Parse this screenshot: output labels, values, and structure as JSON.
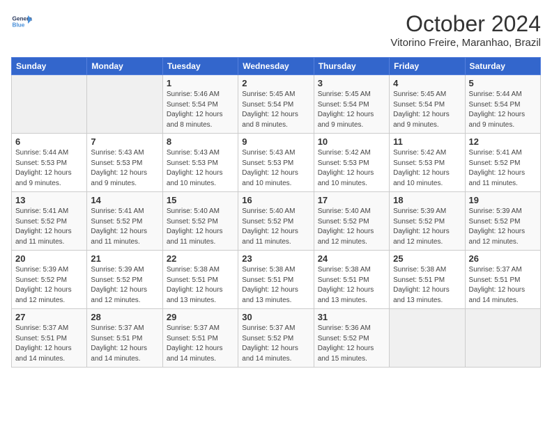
{
  "header": {
    "logo_line1": "General",
    "logo_line2": "Blue",
    "month": "October 2024",
    "location": "Vitorino Freire, Maranhao, Brazil"
  },
  "days_of_week": [
    "Sunday",
    "Monday",
    "Tuesday",
    "Wednesday",
    "Thursday",
    "Friday",
    "Saturday"
  ],
  "weeks": [
    [
      {
        "day": "",
        "sunrise": "",
        "sunset": "",
        "daylight": ""
      },
      {
        "day": "",
        "sunrise": "",
        "sunset": "",
        "daylight": ""
      },
      {
        "day": "1",
        "sunrise": "Sunrise: 5:46 AM",
        "sunset": "Sunset: 5:54 PM",
        "daylight": "Daylight: 12 hours and 8 minutes."
      },
      {
        "day": "2",
        "sunrise": "Sunrise: 5:45 AM",
        "sunset": "Sunset: 5:54 PM",
        "daylight": "Daylight: 12 hours and 8 minutes."
      },
      {
        "day": "3",
        "sunrise": "Sunrise: 5:45 AM",
        "sunset": "Sunset: 5:54 PM",
        "daylight": "Daylight: 12 hours and 9 minutes."
      },
      {
        "day": "4",
        "sunrise": "Sunrise: 5:45 AM",
        "sunset": "Sunset: 5:54 PM",
        "daylight": "Daylight: 12 hours and 9 minutes."
      },
      {
        "day": "5",
        "sunrise": "Sunrise: 5:44 AM",
        "sunset": "Sunset: 5:54 PM",
        "daylight": "Daylight: 12 hours and 9 minutes."
      }
    ],
    [
      {
        "day": "6",
        "sunrise": "Sunrise: 5:44 AM",
        "sunset": "Sunset: 5:53 PM",
        "daylight": "Daylight: 12 hours and 9 minutes."
      },
      {
        "day": "7",
        "sunrise": "Sunrise: 5:43 AM",
        "sunset": "Sunset: 5:53 PM",
        "daylight": "Daylight: 12 hours and 9 minutes."
      },
      {
        "day": "8",
        "sunrise": "Sunrise: 5:43 AM",
        "sunset": "Sunset: 5:53 PM",
        "daylight": "Daylight: 12 hours and 10 minutes."
      },
      {
        "day": "9",
        "sunrise": "Sunrise: 5:43 AM",
        "sunset": "Sunset: 5:53 PM",
        "daylight": "Daylight: 12 hours and 10 minutes."
      },
      {
        "day": "10",
        "sunrise": "Sunrise: 5:42 AM",
        "sunset": "Sunset: 5:53 PM",
        "daylight": "Daylight: 12 hours and 10 minutes."
      },
      {
        "day": "11",
        "sunrise": "Sunrise: 5:42 AM",
        "sunset": "Sunset: 5:53 PM",
        "daylight": "Daylight: 12 hours and 10 minutes."
      },
      {
        "day": "12",
        "sunrise": "Sunrise: 5:41 AM",
        "sunset": "Sunset: 5:52 PM",
        "daylight": "Daylight: 12 hours and 11 minutes."
      }
    ],
    [
      {
        "day": "13",
        "sunrise": "Sunrise: 5:41 AM",
        "sunset": "Sunset: 5:52 PM",
        "daylight": "Daylight: 12 hours and 11 minutes."
      },
      {
        "day": "14",
        "sunrise": "Sunrise: 5:41 AM",
        "sunset": "Sunset: 5:52 PM",
        "daylight": "Daylight: 12 hours and 11 minutes."
      },
      {
        "day": "15",
        "sunrise": "Sunrise: 5:40 AM",
        "sunset": "Sunset: 5:52 PM",
        "daylight": "Daylight: 12 hours and 11 minutes."
      },
      {
        "day": "16",
        "sunrise": "Sunrise: 5:40 AM",
        "sunset": "Sunset: 5:52 PM",
        "daylight": "Daylight: 12 hours and 11 minutes."
      },
      {
        "day": "17",
        "sunrise": "Sunrise: 5:40 AM",
        "sunset": "Sunset: 5:52 PM",
        "daylight": "Daylight: 12 hours and 12 minutes."
      },
      {
        "day": "18",
        "sunrise": "Sunrise: 5:39 AM",
        "sunset": "Sunset: 5:52 PM",
        "daylight": "Daylight: 12 hours and 12 minutes."
      },
      {
        "day": "19",
        "sunrise": "Sunrise: 5:39 AM",
        "sunset": "Sunset: 5:52 PM",
        "daylight": "Daylight: 12 hours and 12 minutes."
      }
    ],
    [
      {
        "day": "20",
        "sunrise": "Sunrise: 5:39 AM",
        "sunset": "Sunset: 5:52 PM",
        "daylight": "Daylight: 12 hours and 12 minutes."
      },
      {
        "day": "21",
        "sunrise": "Sunrise: 5:39 AM",
        "sunset": "Sunset: 5:52 PM",
        "daylight": "Daylight: 12 hours and 12 minutes."
      },
      {
        "day": "22",
        "sunrise": "Sunrise: 5:38 AM",
        "sunset": "Sunset: 5:51 PM",
        "daylight": "Daylight: 12 hours and 13 minutes."
      },
      {
        "day": "23",
        "sunrise": "Sunrise: 5:38 AM",
        "sunset": "Sunset: 5:51 PM",
        "daylight": "Daylight: 12 hours and 13 minutes."
      },
      {
        "day": "24",
        "sunrise": "Sunrise: 5:38 AM",
        "sunset": "Sunset: 5:51 PM",
        "daylight": "Daylight: 12 hours and 13 minutes."
      },
      {
        "day": "25",
        "sunrise": "Sunrise: 5:38 AM",
        "sunset": "Sunset: 5:51 PM",
        "daylight": "Daylight: 12 hours and 13 minutes."
      },
      {
        "day": "26",
        "sunrise": "Sunrise: 5:37 AM",
        "sunset": "Sunset: 5:51 PM",
        "daylight": "Daylight: 12 hours and 14 minutes."
      }
    ],
    [
      {
        "day": "27",
        "sunrise": "Sunrise: 5:37 AM",
        "sunset": "Sunset: 5:51 PM",
        "daylight": "Daylight: 12 hours and 14 minutes."
      },
      {
        "day": "28",
        "sunrise": "Sunrise: 5:37 AM",
        "sunset": "Sunset: 5:51 PM",
        "daylight": "Daylight: 12 hours and 14 minutes."
      },
      {
        "day": "29",
        "sunrise": "Sunrise: 5:37 AM",
        "sunset": "Sunset: 5:51 PM",
        "daylight": "Daylight: 12 hours and 14 minutes."
      },
      {
        "day": "30",
        "sunrise": "Sunrise: 5:37 AM",
        "sunset": "Sunset: 5:52 PM",
        "daylight": "Daylight: 12 hours and 14 minutes."
      },
      {
        "day": "31",
        "sunrise": "Sunrise: 5:36 AM",
        "sunset": "Sunset: 5:52 PM",
        "daylight": "Daylight: 12 hours and 15 minutes."
      },
      {
        "day": "",
        "sunrise": "",
        "sunset": "",
        "daylight": ""
      },
      {
        "day": "",
        "sunrise": "",
        "sunset": "",
        "daylight": ""
      }
    ]
  ]
}
